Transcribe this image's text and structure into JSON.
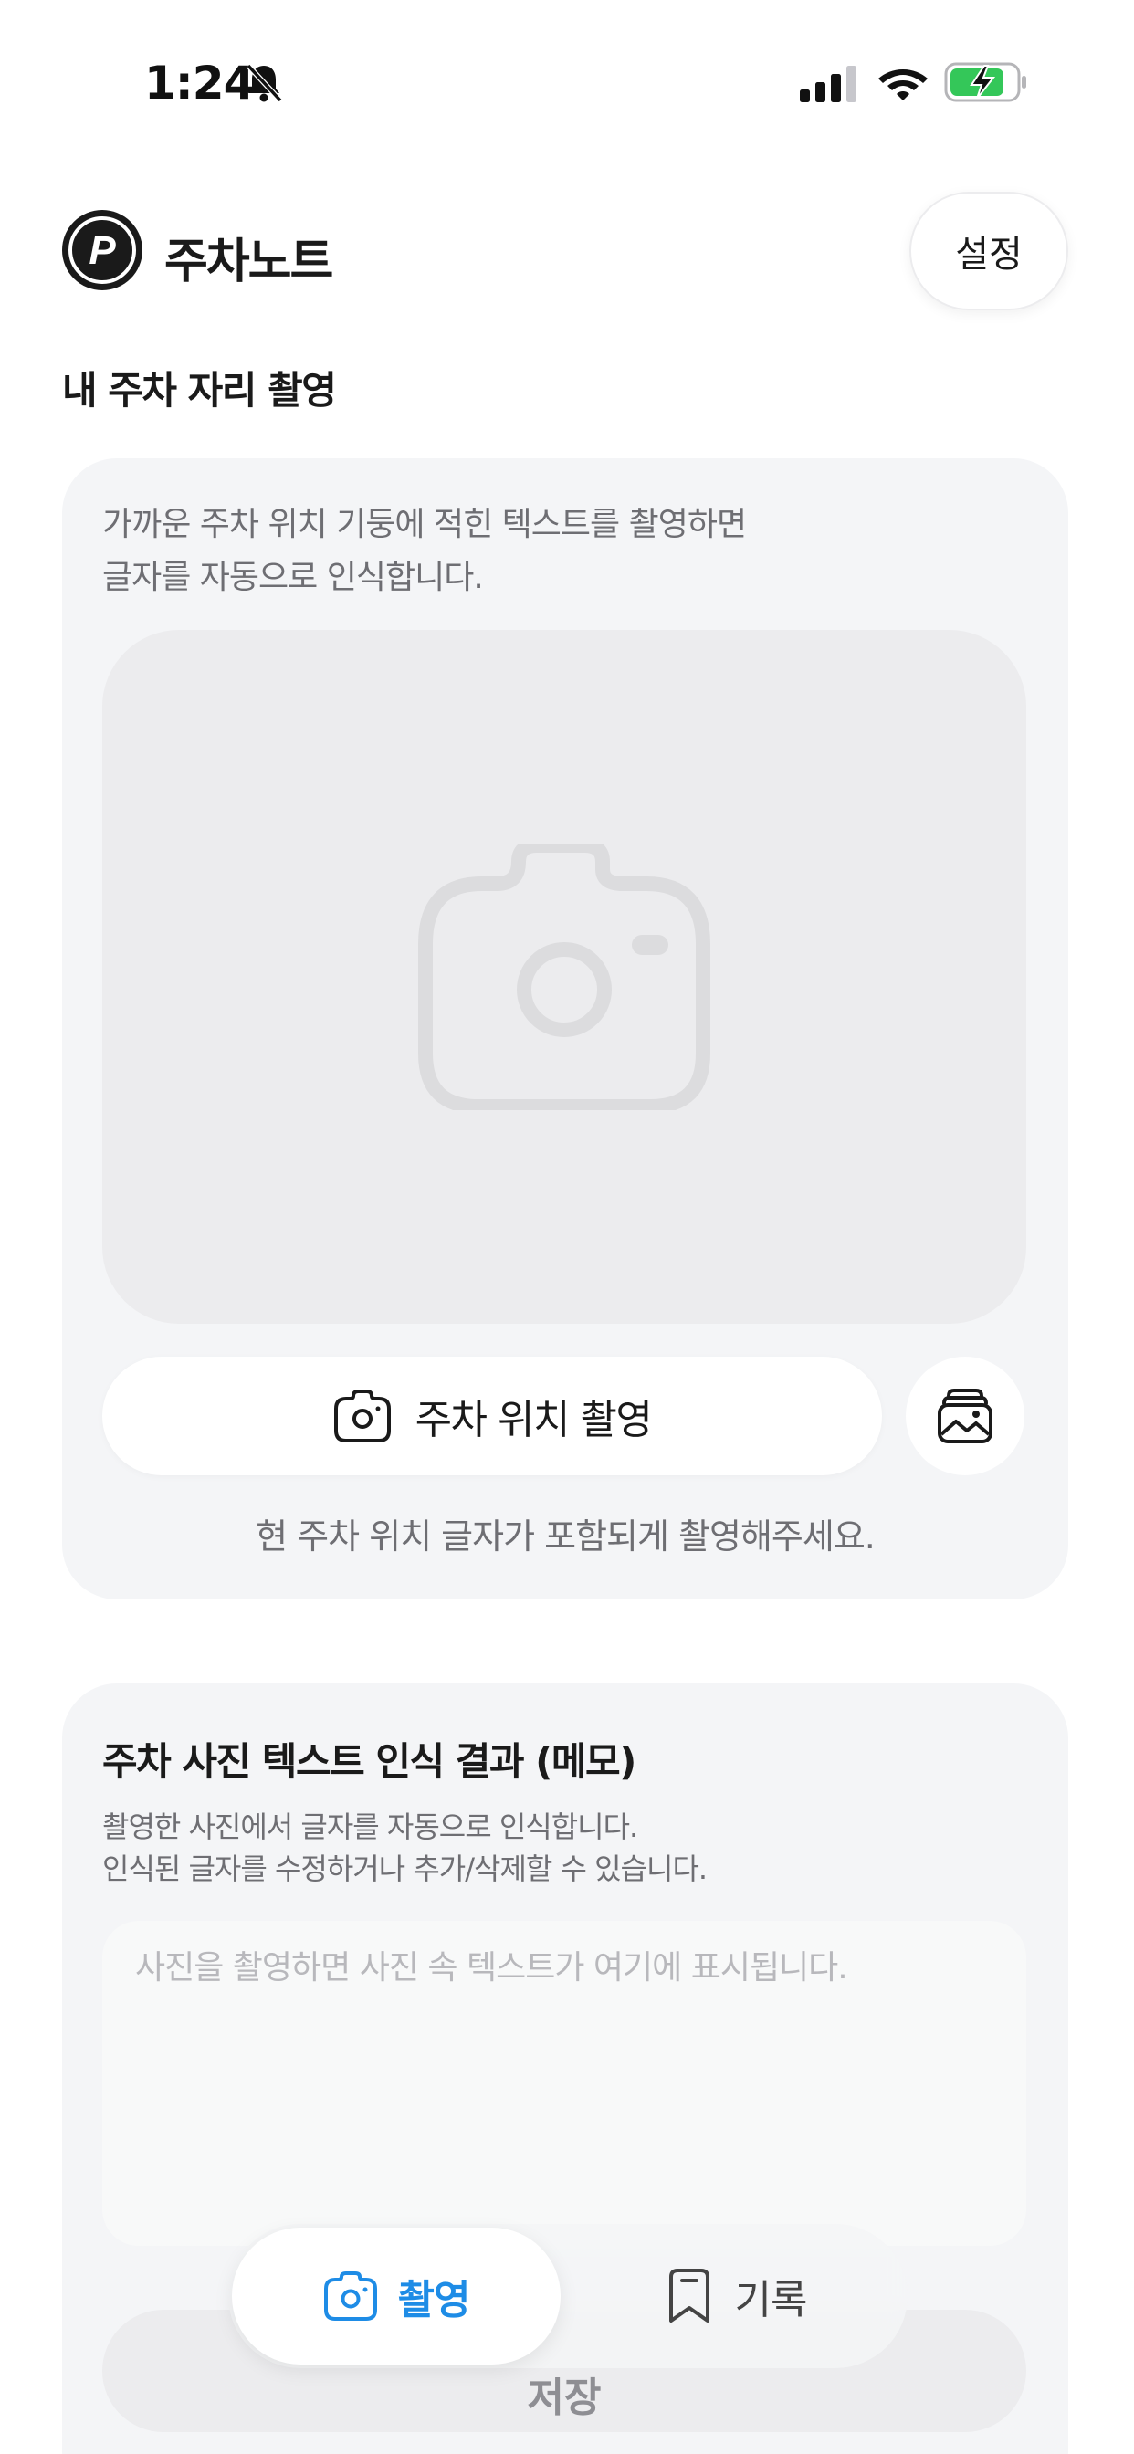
{
  "status_bar": {
    "time": "1:24"
  },
  "header": {
    "logo_letter": "P",
    "app_title": "주차노트",
    "settings_label": "설정"
  },
  "capture_section": {
    "title": "내 주차 자리 촬영",
    "description": "가까운 주차 위치 기둥에 적힌 텍스트를 촬영하면\n글자를 자동으로 인식합니다.",
    "capture_button_label": "주차 위치 촬영",
    "hint": "현 주차 위치 글자가 포함되게 촬영해주세요."
  },
  "ocr_section": {
    "title": "주차 사진 텍스트 인식 결과 (메모)",
    "description": "촬영한 사진에서 글자를 자동으로 인식합니다.\n인식된 글자를 수정하거나 추가/삭제할 수 있습니다.",
    "textarea_value": "",
    "textarea_placeholder": "사진을 촬영하면 사진 속 텍스트가 여기에 표시됩니다.",
    "save_label": "저장"
  },
  "tab_bar": {
    "tabs": [
      {
        "label": "촬영",
        "icon": "camera-icon",
        "active": true
      },
      {
        "label": "기록",
        "icon": "bookmark-icon",
        "active": false
      }
    ]
  },
  "colors": {
    "accent": "#1e8ce6",
    "card_background": "#f4f5f7",
    "secondary_text": "#6e6e73",
    "battery_charging": "#34c759"
  }
}
